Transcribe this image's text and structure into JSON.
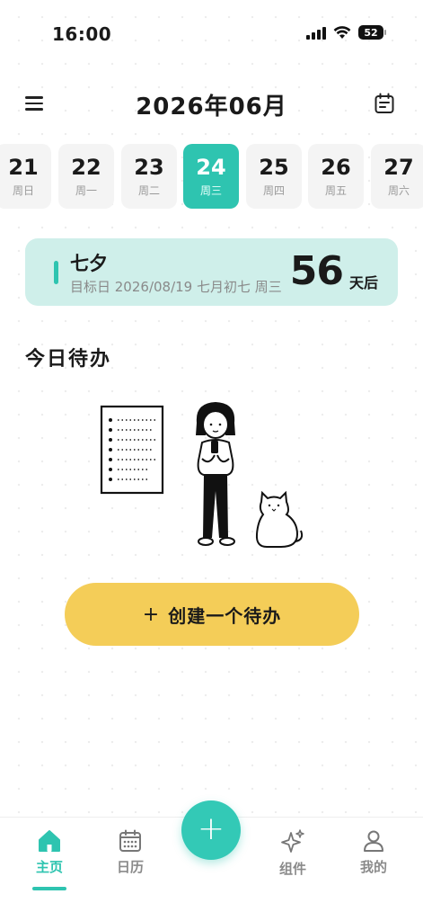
{
  "status": {
    "time": "16:00",
    "battery": "52"
  },
  "header": {
    "title": "2026年06月"
  },
  "days": [
    {
      "num": "21",
      "week": "周日",
      "active": false
    },
    {
      "num": "22",
      "week": "周一",
      "active": false
    },
    {
      "num": "23",
      "week": "周二",
      "active": false
    },
    {
      "num": "24",
      "week": "周三",
      "active": true
    },
    {
      "num": "25",
      "week": "周四",
      "active": false
    },
    {
      "num": "26",
      "week": "周五",
      "active": false
    },
    {
      "num": "27",
      "week": "周六",
      "active": false
    }
  ],
  "countdown": {
    "title": "七夕",
    "subtitle": "目标日 2026/08/19 七月初七 周三",
    "days": "56",
    "unit": "天后"
  },
  "todo": {
    "section_title": "今日待办",
    "create_label": "创建一个待办",
    "create_icon": "plus-icon"
  },
  "tabbar": {
    "items": [
      {
        "label": "主页",
        "icon": "home-icon",
        "active": true
      },
      {
        "label": "日历",
        "icon": "calendar-icon",
        "active": false
      },
      {
        "label": "组件",
        "icon": "sparkle-icon",
        "active": false
      },
      {
        "label": "我的",
        "icon": "person-icon",
        "active": false
      }
    ],
    "fab_icon": "plus-icon"
  },
  "colors": {
    "accent": "#2ec4b0",
    "countdown_bg": "#cfefea",
    "button_yellow": "#f4cd58"
  }
}
